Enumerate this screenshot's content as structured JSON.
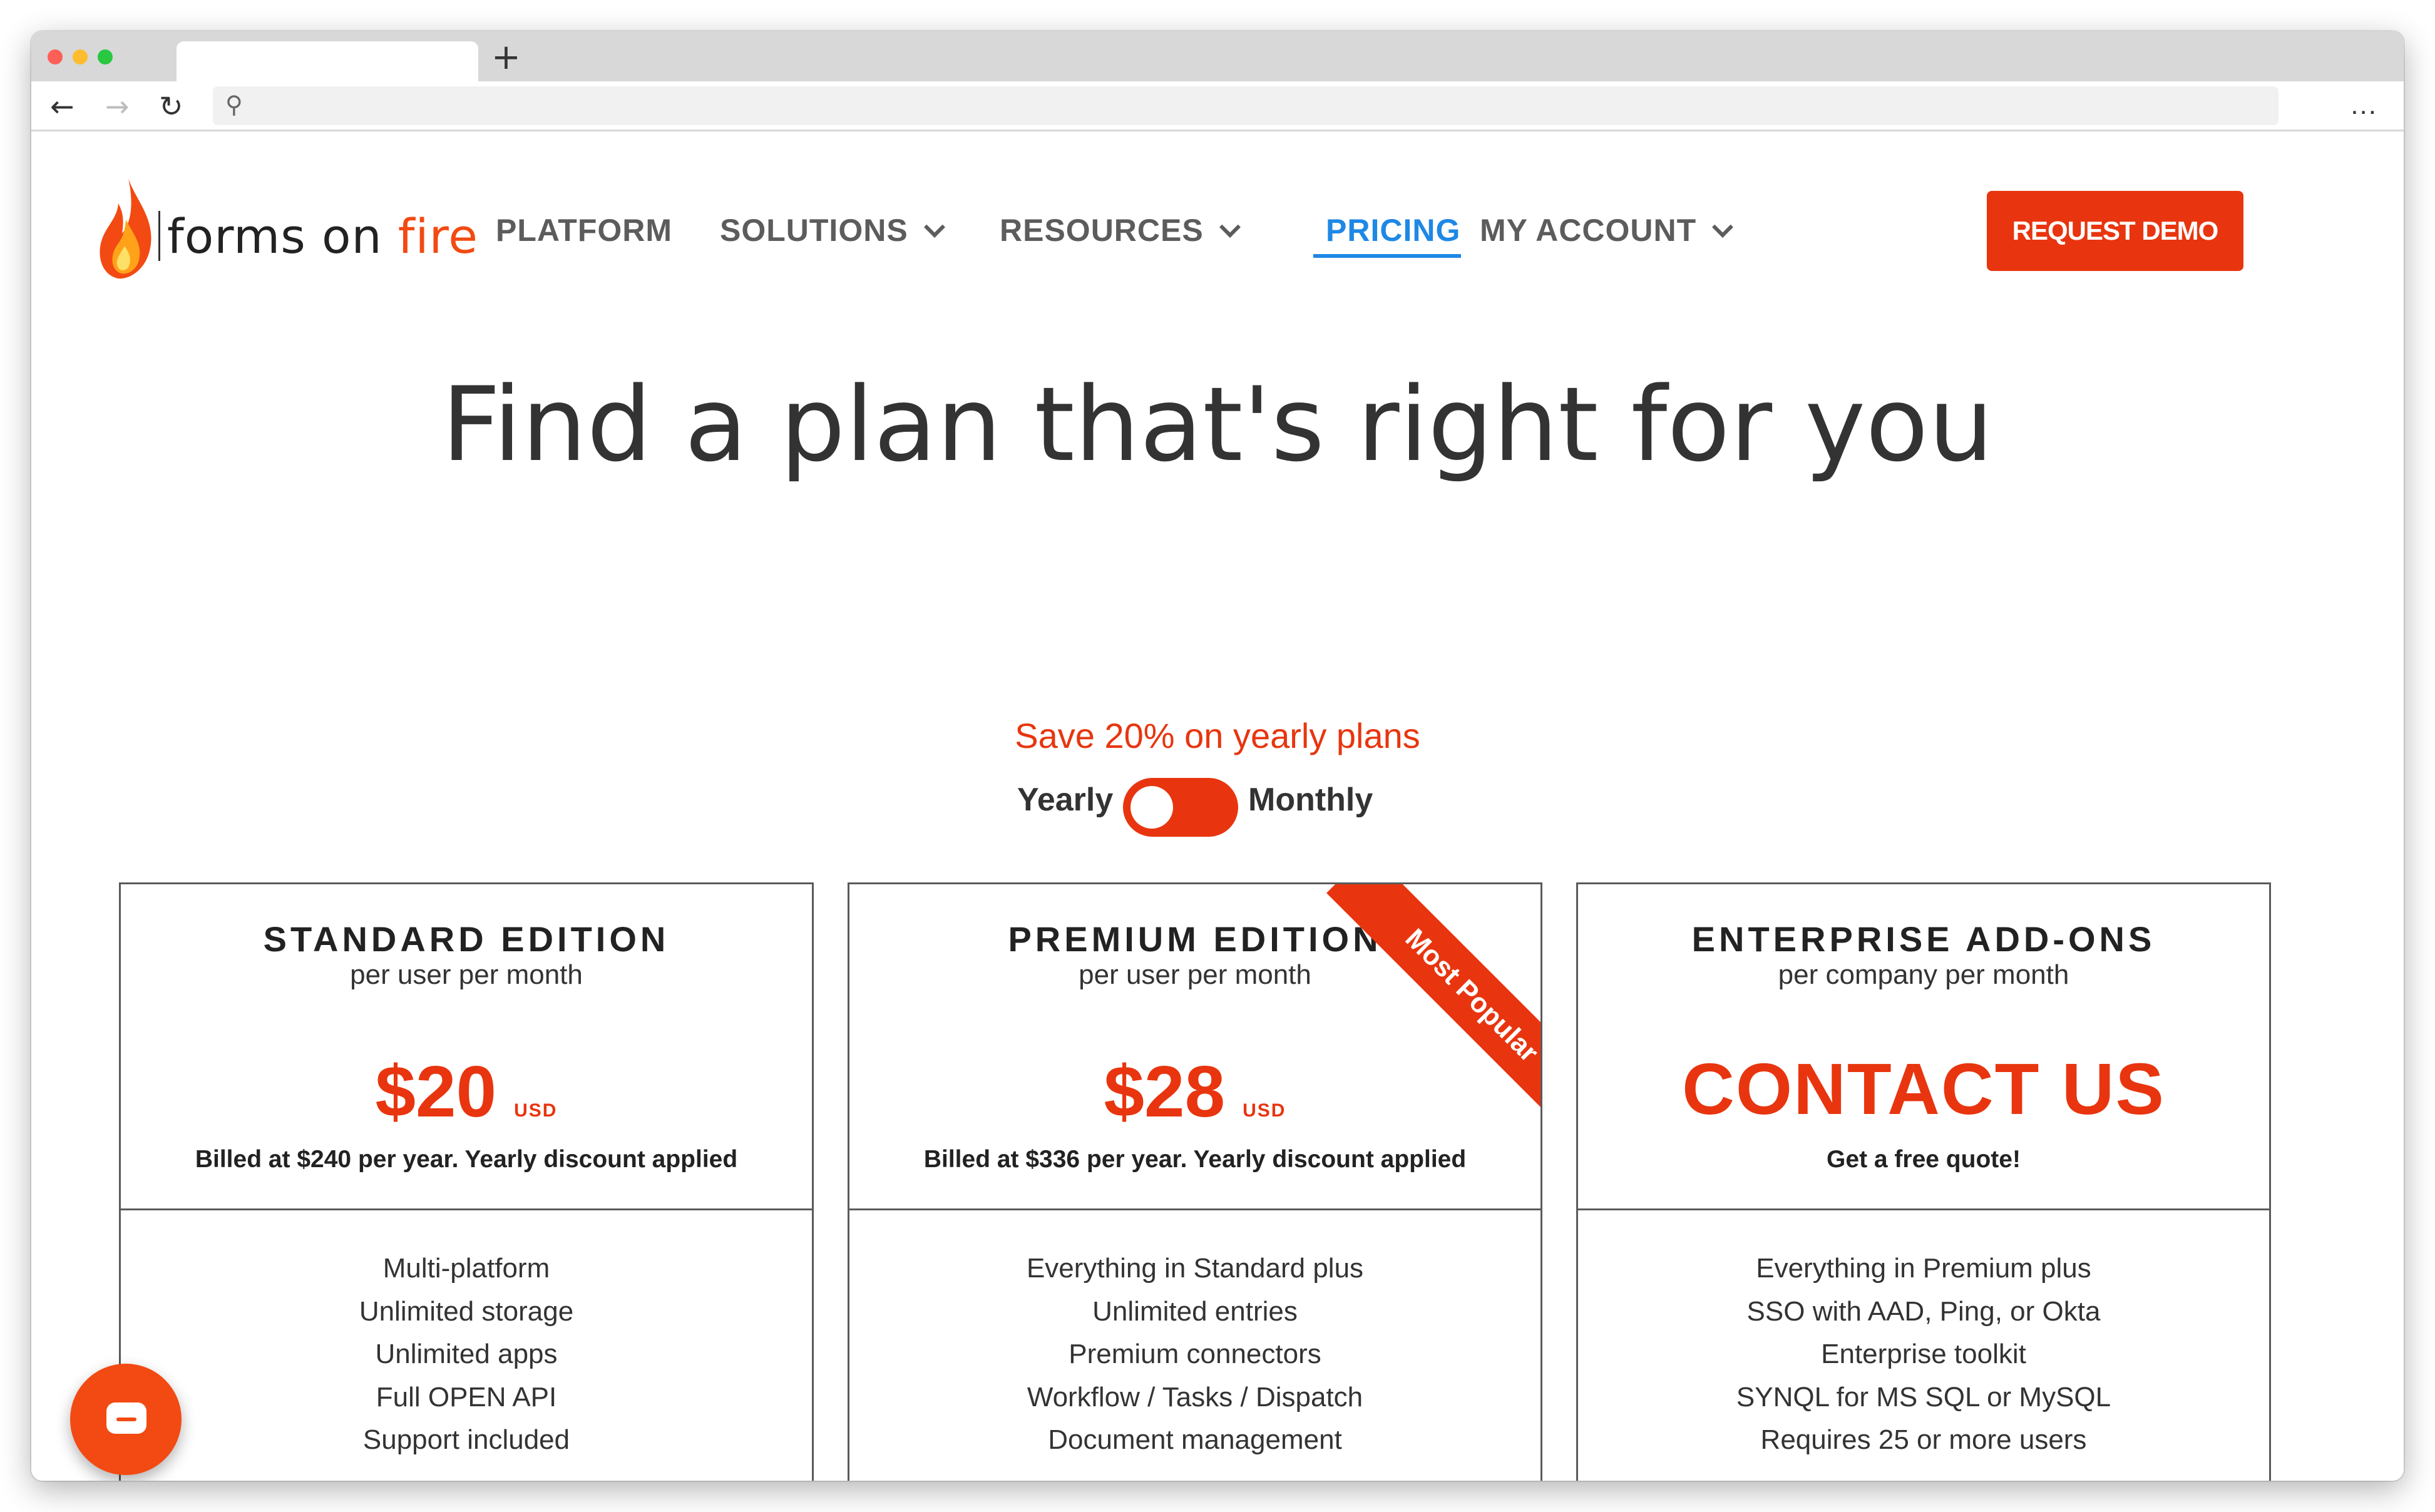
{
  "browser": {
    "new_tab_glyph": "+",
    "menu_glyph": "...",
    "back_glyph": "←",
    "forward_glyph": "→",
    "reload_glyph": "↻",
    "search_glyph": "⚲"
  },
  "header": {
    "logo": {
      "text_main": "forms on ",
      "text_accent": "fire"
    },
    "nav": [
      {
        "label": "PLATFORM"
      },
      {
        "label": "SOLUTIONS"
      },
      {
        "label": "RESOURCES"
      },
      {
        "label": "PRICING"
      },
      {
        "label": "MY ACCOUNT"
      }
    ],
    "demo_label": "REQUEST DEMO"
  },
  "hero": {
    "title": "Find a plan that's right for you"
  },
  "billing": {
    "save_note": "Save 20% on yearly plans",
    "yearly_label": "Yearly",
    "monthly_label": "Monthly"
  },
  "plans": [
    {
      "title": "STANDARD EDITION",
      "subtitle": "per user per month",
      "price": "$20",
      "currency": "USD",
      "billed": "Billed at $240 per year. Yearly discount applied",
      "features": [
        "Multi-platform",
        "Unlimited storage",
        "Unlimited apps",
        "Full OPEN API",
        "Support included"
      ]
    },
    {
      "title": "PREMIUM EDITION",
      "subtitle": "per user per month",
      "price": "$28",
      "currency": "USD",
      "billed": "Billed at $336 per year. Yearly discount applied",
      "ribbon": "Most Popular",
      "features": [
        "Everything in Standard plus",
        "Unlimited entries",
        "Premium connectors",
        "Workflow / Tasks / Dispatch",
        "Document management"
      ]
    },
    {
      "title": "ENTERPRISE ADD-ONS",
      "subtitle": "per company per month",
      "price_text": "CONTACT US",
      "billed": "Get a free quote!",
      "features": [
        "Everything in Premium plus",
        "SSO with AAD, Ping, or Okta",
        "Enterprise toolkit",
        "SYNQL for MS SQL or MySQL",
        "Requires 25 or more users"
      ]
    }
  ],
  "colors": {
    "accent": "#e8350f",
    "nav_active": "#1e88e5",
    "text": "#333333"
  }
}
